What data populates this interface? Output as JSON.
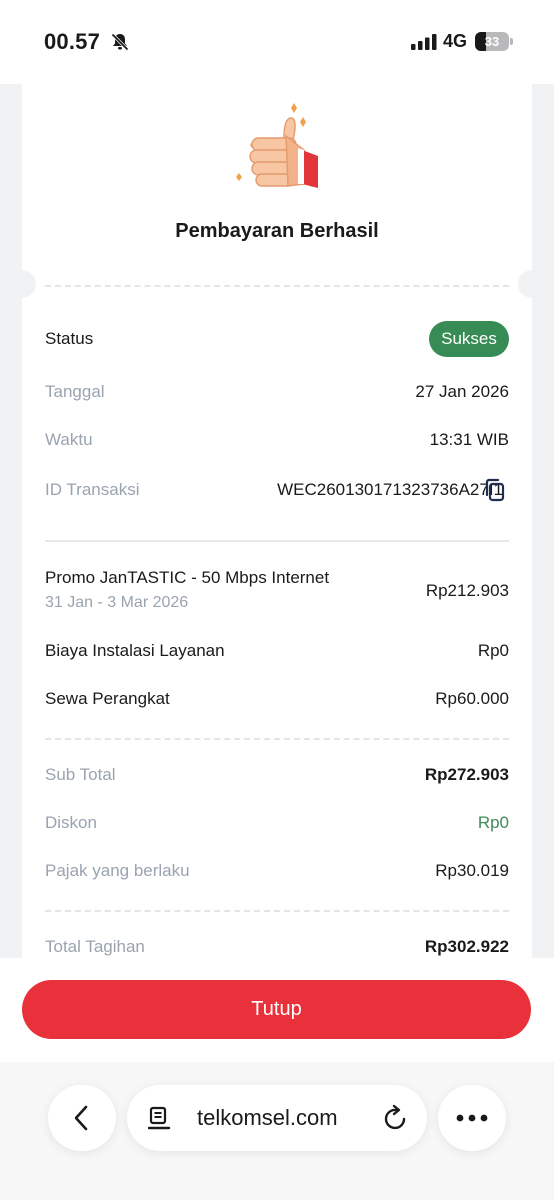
{
  "status_bar": {
    "time": "00.57",
    "network": "4G",
    "battery": "33",
    "battery_level": 0.33
  },
  "receipt": {
    "title": "Pembayaran Berhasil",
    "status": {
      "label": "Status",
      "value": "Sukses"
    },
    "details": [
      {
        "label": "Tanggal",
        "value": "27 Jan 2026"
      },
      {
        "label": "Waktu",
        "value": "13:31 WIB"
      },
      {
        "label": "ID Transaksi",
        "value": "WEC260130171323736A27I1"
      }
    ],
    "items": [
      {
        "label": "Promo JanTASTIC - 50 Mbps Internet",
        "sub": "31 Jan - 3 Mar 2026",
        "value": "Rp212.903"
      },
      {
        "label": "Biaya Instalasi Layanan",
        "value": "Rp0"
      },
      {
        "label": "Sewa Perangkat",
        "value": "Rp60.000"
      }
    ],
    "summary": [
      {
        "label": "Sub Total",
        "value": "Rp272.903"
      },
      {
        "label": "Diskon",
        "value": "Rp0"
      },
      {
        "label": "Pajak yang berlaku",
        "value": "Rp30.019"
      }
    ],
    "total": {
      "label": "Total Tagihan",
      "value": "Rp302.922"
    }
  },
  "actions": {
    "close_label": "Tutup"
  },
  "browser": {
    "url": "telkomsel.com"
  },
  "colors": {
    "accent_red": "#e8313a",
    "success_green": "#368c54",
    "discount_green": "#3e8a58",
    "muted_text": "#9aa3b0"
  },
  "icons": [
    "bell-mute-icon",
    "signal-icon",
    "battery-icon",
    "thumbs-up-icon",
    "copy-icon",
    "back-chevron-icon",
    "reader-icon",
    "reload-icon",
    "more-icon"
  ]
}
